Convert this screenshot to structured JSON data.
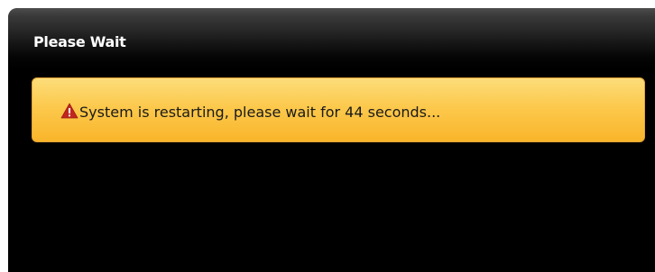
{
  "dialog": {
    "title": "Please Wait"
  },
  "alert": {
    "icon": "warning-triangle-icon",
    "message": "System is restarting, please wait for 44 seconds..."
  },
  "colors": {
    "alert_background": "#fcc94d",
    "alert_border": "#e2a233",
    "warning_icon": "#c0271e",
    "dialog_background": "#000000",
    "title_text": "#ffffff"
  }
}
